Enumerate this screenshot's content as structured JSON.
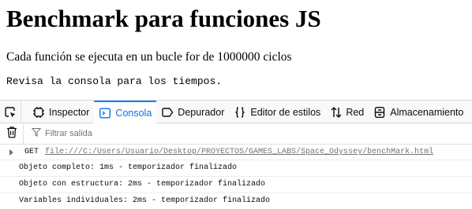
{
  "page": {
    "title": "Benchmark para funciones JS",
    "description": "Cada función se ejecuta en un bucle for de 1000000 ciclos",
    "hint": "Revisa la consola para los tiempos."
  },
  "devtools": {
    "tabs": [
      {
        "label": "Inspector",
        "icon": "inspector-icon"
      },
      {
        "label": "Consola",
        "icon": "console-icon",
        "active": true
      },
      {
        "label": "Depurador",
        "icon": "debugger-icon"
      },
      {
        "label": "Editor de estilos",
        "icon": "style-editor-icon"
      },
      {
        "label": "Red",
        "icon": "network-icon"
      },
      {
        "label": "Almacenamiento",
        "icon": "storage-icon"
      }
    ],
    "filter_placeholder": "Filtrar salida",
    "colors": {
      "accent": "#0a84ff",
      "active_text": "#0074e8",
      "muted": "#737373"
    },
    "console": {
      "request": {
        "method": "GET",
        "url": "file:///C:/Users/Usuario/Desktop/PROYECTOS/GAMES_LABS/Space_Odyssey/benchMark.html"
      },
      "messages": [
        "Objeto completo: 1ms - temporizador finalizado",
        "Objeto con estructura: 2ms - temporizador finalizado",
        "Variables individuales: 2ms - temporizador finalizado"
      ]
    }
  }
}
